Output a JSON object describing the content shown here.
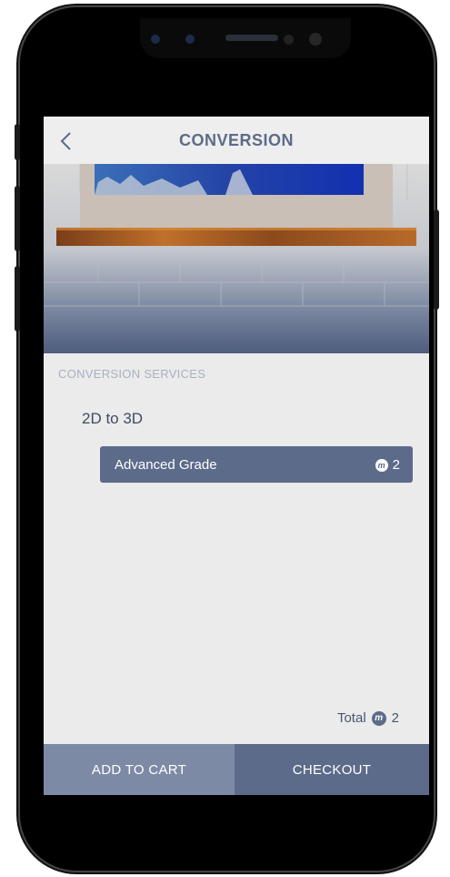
{
  "header": {
    "title": "CONVERSION",
    "back_icon": "chevron-left-icon"
  },
  "services": {
    "section_label": "CONVERSION SERVICES",
    "service_name": "2D to 3D",
    "selected_grade": {
      "label": "Advanced Grade",
      "credits": "2",
      "credit_icon": "credit-coin-icon"
    }
  },
  "summary": {
    "total_label": "Total",
    "total_credits": "2"
  },
  "actions": {
    "add_to_cart_label": "ADD TO CART",
    "checkout_label": "CHECKOUT"
  },
  "colors": {
    "accent": "#5d6b8a",
    "accent_light": "#7d8aa6",
    "screen_bg": "#ebebeb",
    "section_label": "#a7b0c4"
  }
}
